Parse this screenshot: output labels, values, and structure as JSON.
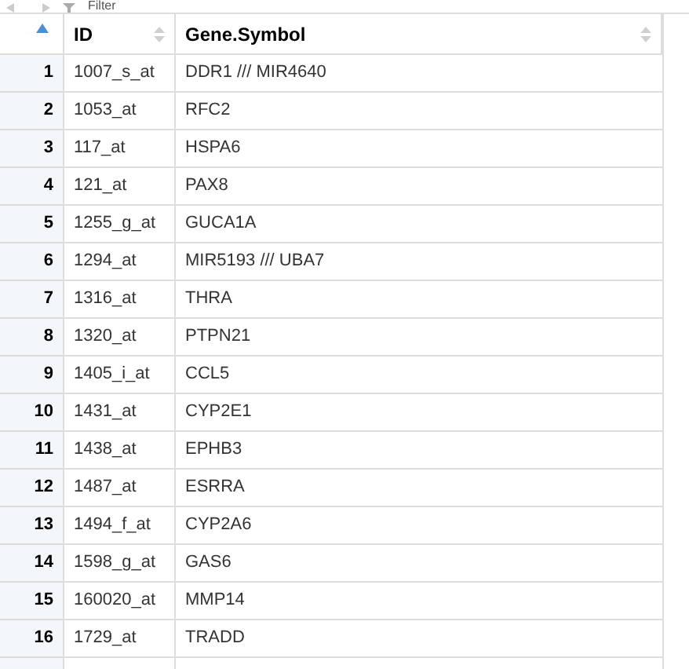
{
  "toolbar": {
    "filter_label": "Filter"
  },
  "table": {
    "index_column": {
      "sorted": true
    },
    "columns": [
      {
        "label": "ID",
        "sorted": false
      },
      {
        "label": "Gene.Symbol",
        "sorted": false
      }
    ],
    "rows": [
      {
        "n": "1",
        "id": "1007_s_at",
        "symbol": "DDR1 /// MIR4640"
      },
      {
        "n": "2",
        "id": "1053_at",
        "symbol": "RFC2"
      },
      {
        "n": "3",
        "id": "117_at",
        "symbol": "HSPA6"
      },
      {
        "n": "4",
        "id": "121_at",
        "symbol": "PAX8"
      },
      {
        "n": "5",
        "id": "1255_g_at",
        "symbol": "GUCA1A"
      },
      {
        "n": "6",
        "id": "1294_at",
        "symbol": "MIR5193 /// UBA7"
      },
      {
        "n": "7",
        "id": "1316_at",
        "symbol": "THRA"
      },
      {
        "n": "8",
        "id": "1320_at",
        "symbol": "PTPN21"
      },
      {
        "n": "9",
        "id": "1405_i_at",
        "symbol": "CCL5"
      },
      {
        "n": "10",
        "id": "1431_at",
        "symbol": "CYP2E1"
      },
      {
        "n": "11",
        "id": "1438_at",
        "symbol": "EPHB3"
      },
      {
        "n": "12",
        "id": "1487_at",
        "symbol": "ESRRA"
      },
      {
        "n": "13",
        "id": "1494_f_at",
        "symbol": "CYP2A6"
      },
      {
        "n": "14",
        "id": "1598_g_at",
        "symbol": "GAS6"
      },
      {
        "n": "15",
        "id": "160020_at",
        "symbol": "MMP14"
      },
      {
        "n": "16",
        "id": "1729_at",
        "symbol": "TRADD"
      }
    ]
  }
}
